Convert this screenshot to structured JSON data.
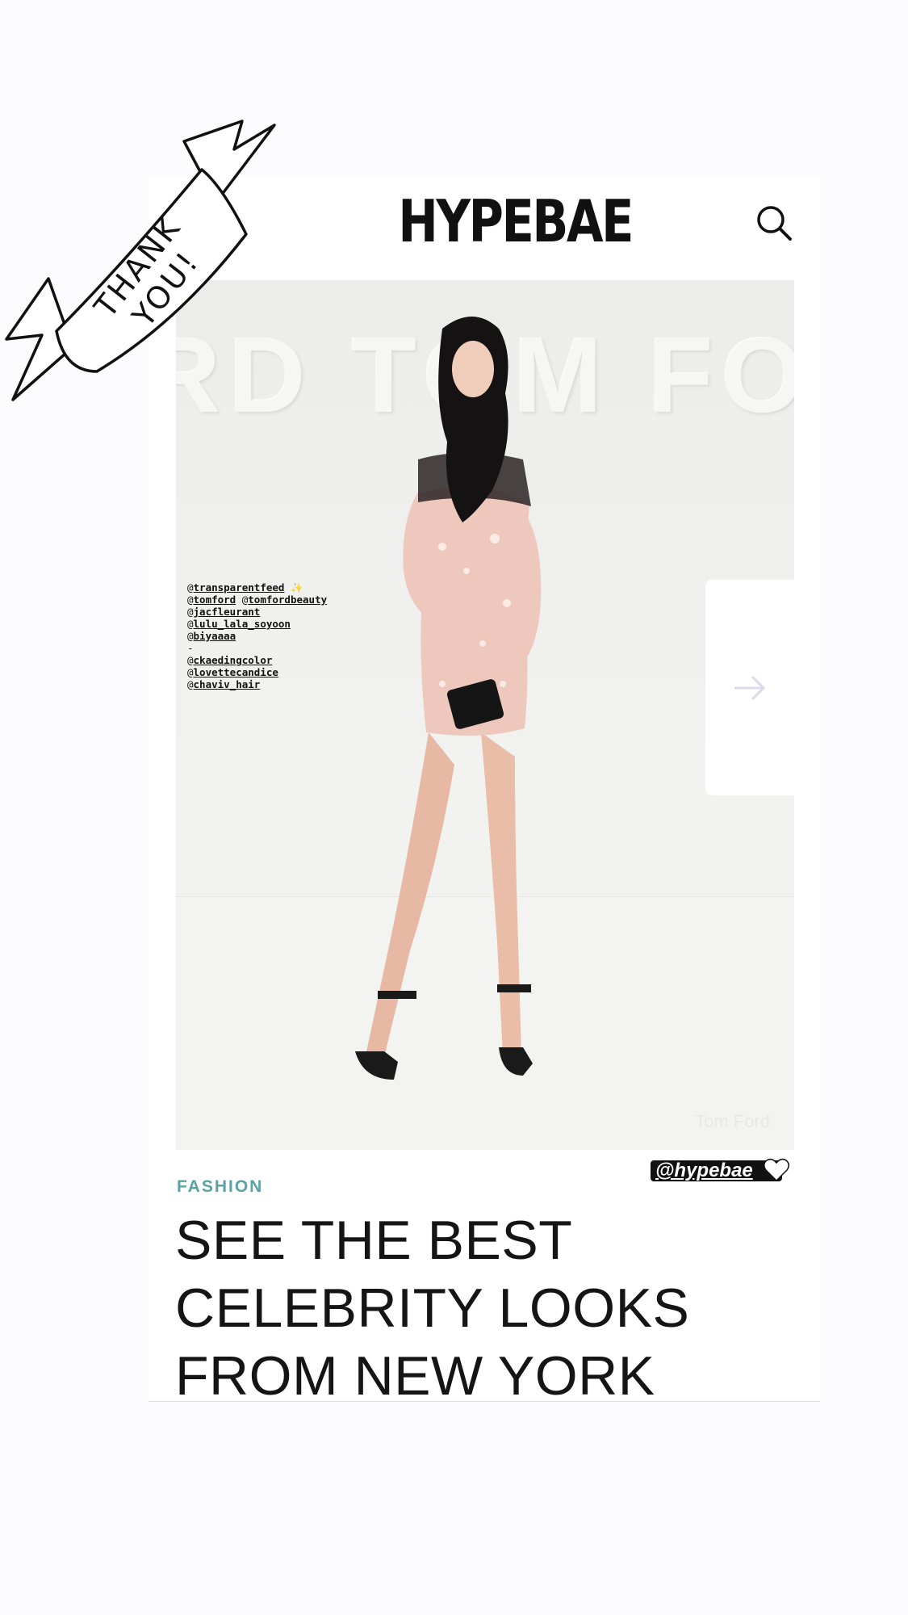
{
  "header": {
    "brand": "HYPEBAE"
  },
  "hero": {
    "watermark": "RD    TOM FO",
    "photo_credit": "Tom Ford"
  },
  "story_tags": [
    {
      "handle": "@",
      "name": "transparentfeed",
      "suffix": " ✨"
    },
    {
      "handle": "@",
      "name": "tomford",
      "suffix": " @",
      "name2": "tomfordbeauty"
    },
    {
      "handle": "@",
      "name": "jacfleurant",
      "suffix": ""
    },
    {
      "handle": "@",
      "name": "lulu_lala_soyoon",
      "suffix": ""
    },
    {
      "handle": "@",
      "name": "biyaaaa",
      "suffix": ""
    },
    {
      "handle": "-",
      "name": "",
      "suffix": ""
    },
    {
      "handle": "@",
      "name": "ckaedingcolor",
      "suffix": ""
    },
    {
      "handle": "@",
      "name": "lovettecandice",
      "suffix": ""
    },
    {
      "handle": "@",
      "name": "chaviv_hair",
      "suffix": ""
    }
  ],
  "sticker": {
    "handle": "@hypebae",
    "banner_text": "THANK YOU!"
  },
  "article": {
    "category": "FASHION",
    "headline_lines": [
      "SEE THE BEST",
      "CELEBRITY LOOKS",
      "FROM NEW YORK"
    ]
  },
  "icons": {
    "search": "search-icon",
    "next": "arrow-right-icon",
    "heart": "heart-icon"
  },
  "colors": {
    "category": "#5aa3a3",
    "accent_dark": "#111111",
    "dress": "#eec8bd"
  }
}
